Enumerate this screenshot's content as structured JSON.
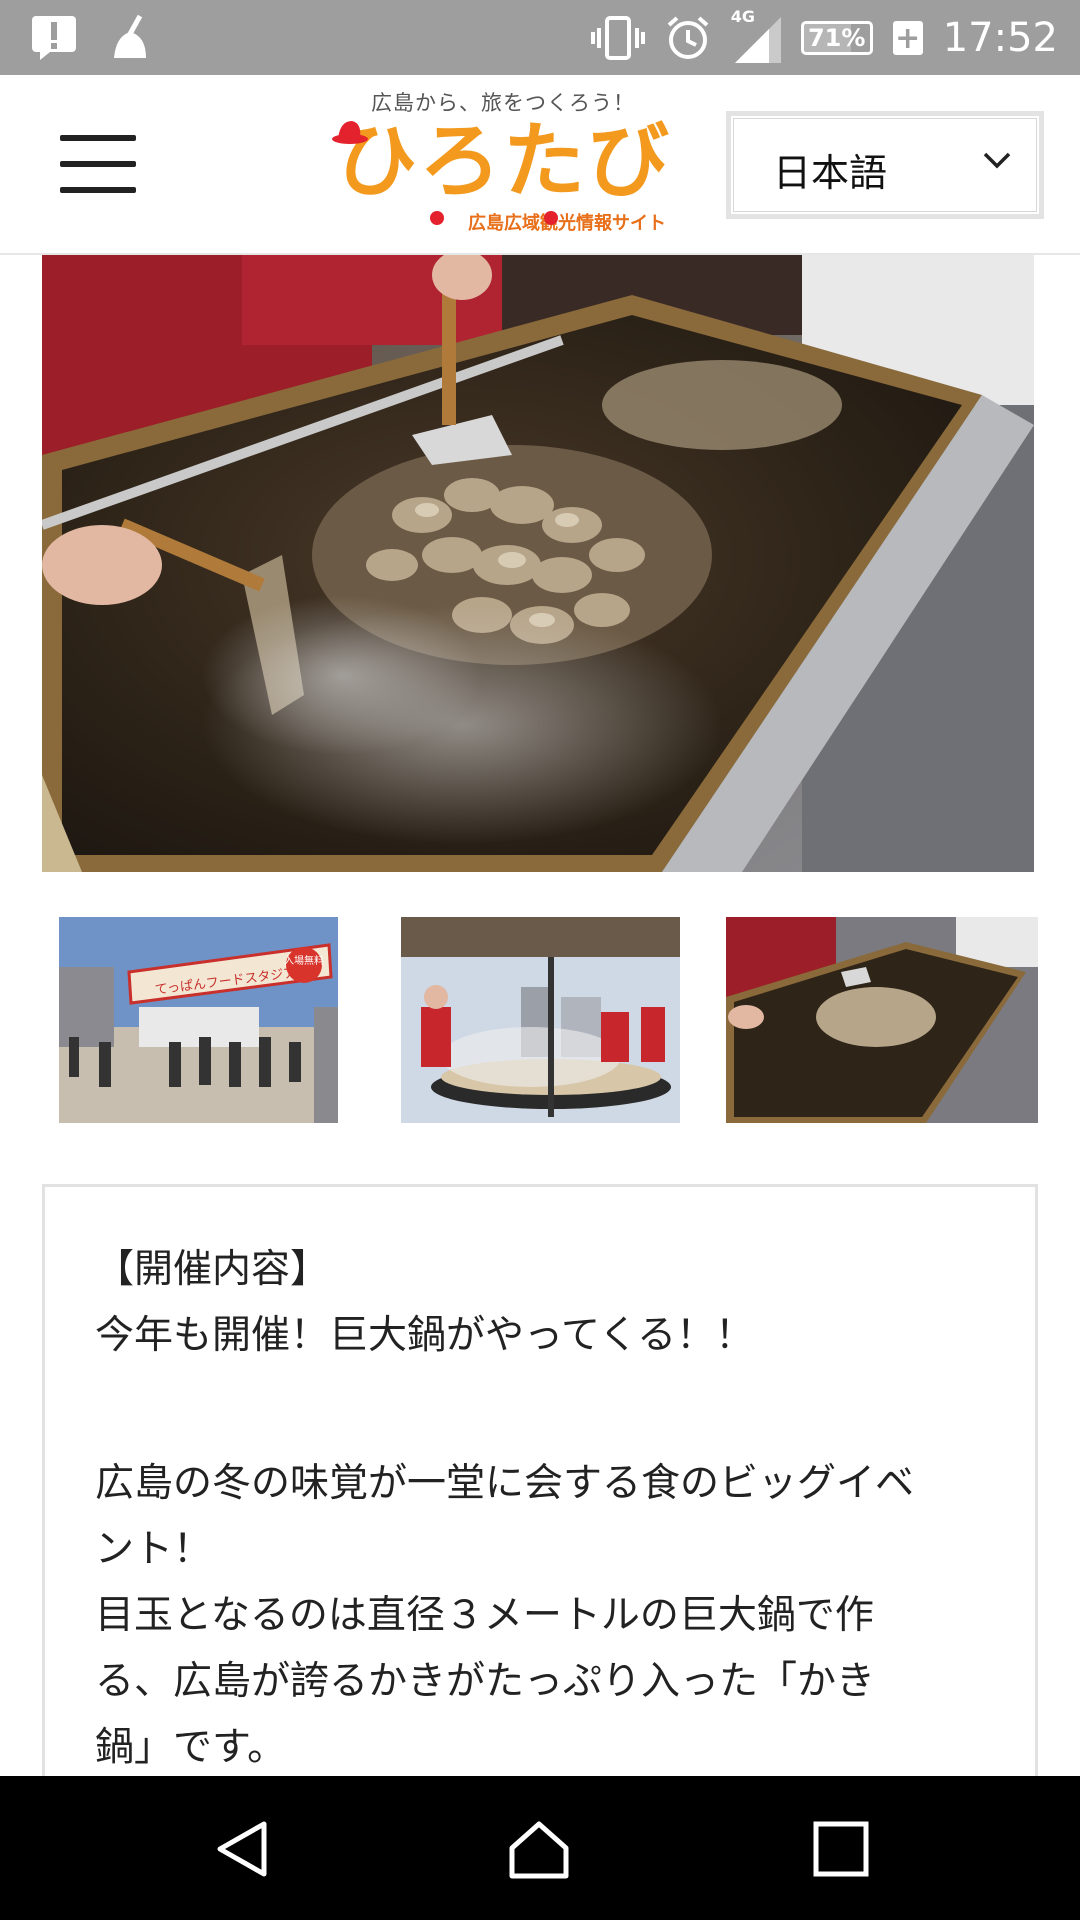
{
  "status_bar": {
    "time": "17:52",
    "battery_percent": "71%",
    "battery_level": 0.71,
    "network": "4G",
    "icons": [
      "alert-icon",
      "cleaner-icon",
      "vibrate-icon",
      "alarm-icon",
      "signal-icon",
      "battery-icon",
      "charging-plus-icon"
    ]
  },
  "header": {
    "logo_tagline": "広島から、旅をつくろう！",
    "logo_main": "ひろたび",
    "logo_subtitle": "広島広域観光情報サイト",
    "menu_icon": "hamburger-icon",
    "language_select": {
      "selected": "日本語",
      "icon": "chevron-down-icon"
    }
  },
  "gallery": {
    "banner_text": "てっぱんフードスタジアム",
    "banner_badge": "入場無料",
    "thumbnails": [
      "event-entrance-gate",
      "giant-pot-cooking",
      "oysters-on-griddle"
    ]
  },
  "content": {
    "heading": "【開催内容】",
    "line1": "今年も開催！巨大鍋がやってくる！！",
    "para2_line1": "広島の冬の味覚が一堂に会する食のビッグイベ",
    "para2_line2": "ント！",
    "para3_line1": "目玉となるのは直径３メートルの巨大鍋で作",
    "para3_line2": "る、広島が誇るかきがたっぷり入った「かき",
    "para3_line3": "鍋」です。"
  },
  "nav_bar": {
    "back": "back-icon",
    "home": "home-icon",
    "recents": "recents-icon"
  },
  "colors": {
    "status_bar": "#9e9e9e",
    "logo_orange": "#f39a1e",
    "logo_red": "#e3222d",
    "nav_bar": "#000000"
  }
}
